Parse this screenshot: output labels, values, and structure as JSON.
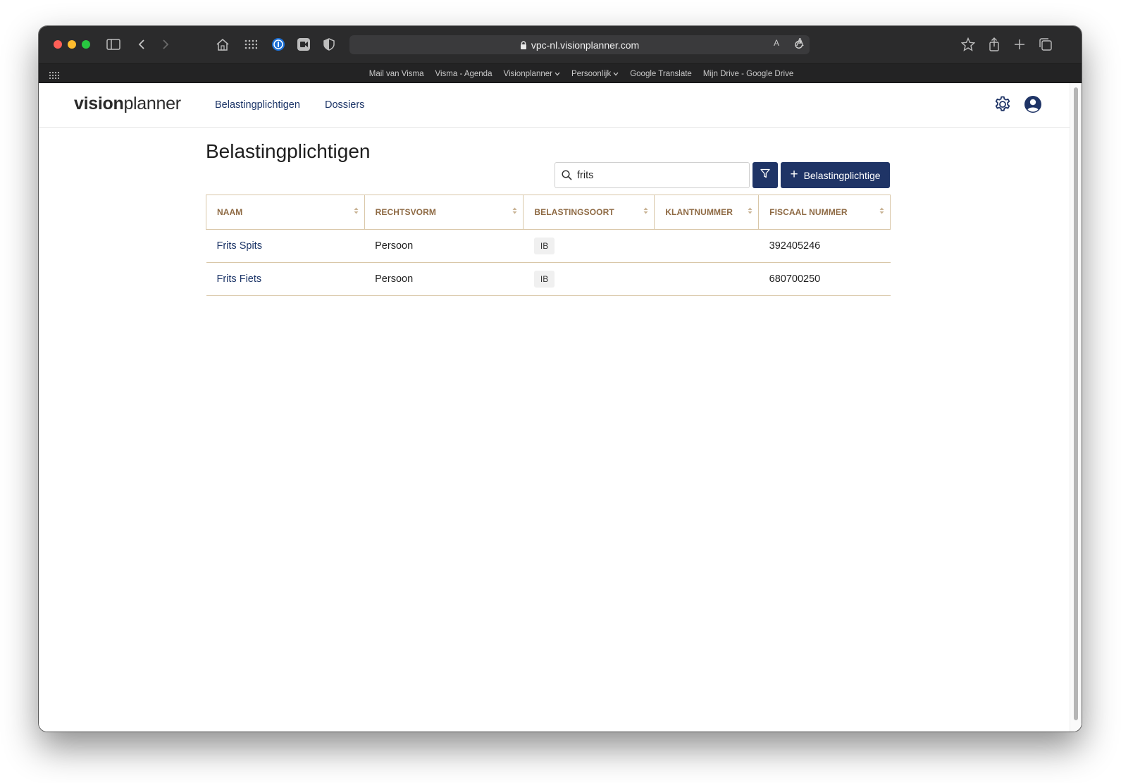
{
  "browser": {
    "url": "vpc-nl.visionplanner.com",
    "text_size_small": "A",
    "text_size_large": "A",
    "bookmarks": [
      {
        "label": "Mail van Visma",
        "dropdown": false
      },
      {
        "label": "Visma - Agenda",
        "dropdown": false
      },
      {
        "label": "Visionplanner",
        "dropdown": true
      },
      {
        "label": "Persoonlijk",
        "dropdown": true
      },
      {
        "label": "Google Translate",
        "dropdown": false
      },
      {
        "label": "Mijn Drive - Google Drive",
        "dropdown": false
      }
    ]
  },
  "app": {
    "logo_bold": "vision",
    "logo_light": "planner",
    "nav": {
      "taxpayers": "Belastingplichtigen",
      "dossiers": "Dossiers"
    }
  },
  "main": {
    "title": "Belastingplichtigen",
    "search_value": "frits",
    "add_button_label": "Belastingplichtige",
    "columns": [
      "NAAM",
      "RECHTSVORM",
      "BELASTINGSOORT",
      "KLANTNUMMER",
      "FISCAAL NUMMER"
    ],
    "rows": [
      {
        "naam": "Frits Spits",
        "rechtsvorm": "Persoon",
        "belastingsoort": "IB",
        "klantnummer": "",
        "fiscaal_nummer": "392405246"
      },
      {
        "naam": "Frits Fiets",
        "rechtsvorm": "Persoon",
        "belastingsoort": "IB",
        "klantnummer": "",
        "fiscaal_nummer": "680700250"
      }
    ]
  },
  "colors": {
    "primary": "#1f3466",
    "header_text": "#8e6a44",
    "border": "#d9c7a8",
    "link": "#1b3467"
  }
}
